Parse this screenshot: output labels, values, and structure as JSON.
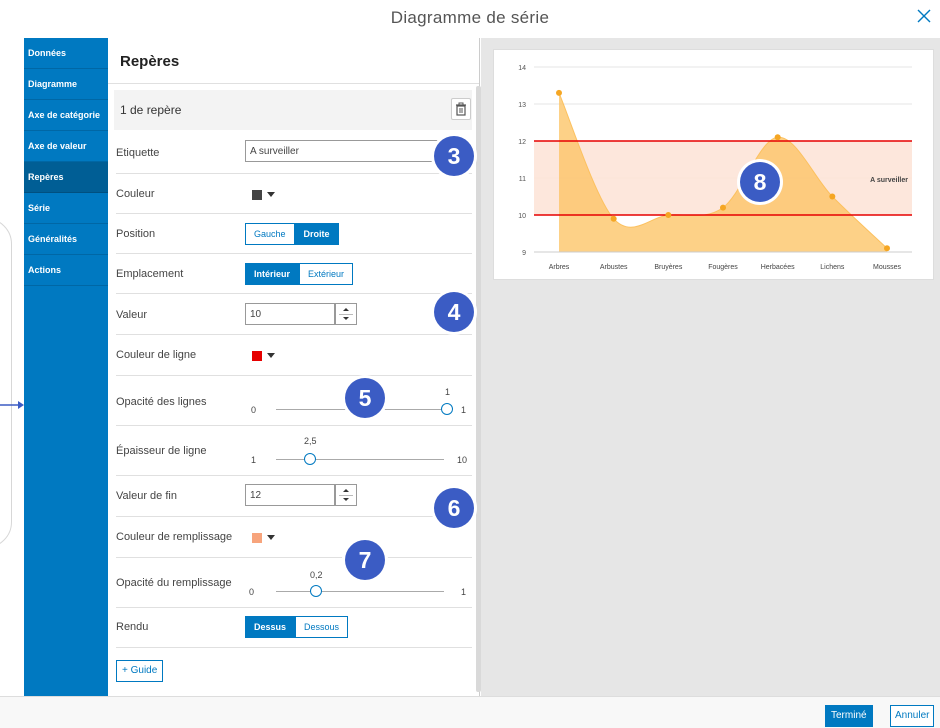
{
  "window": {
    "title": "Diagramme de série"
  },
  "sidebar": {
    "items": [
      {
        "label": "Données"
      },
      {
        "label": "Diagramme"
      },
      {
        "label": "Axe de catégorie"
      },
      {
        "label": "Axe de valeur"
      },
      {
        "label": "Repères",
        "active": true
      },
      {
        "label": "Série"
      },
      {
        "label": "Généralités"
      },
      {
        "label": "Actions"
      }
    ]
  },
  "panel": {
    "title": "Repères",
    "marker_header": "1 de repère",
    "fields": {
      "label": {
        "label": "Etiquette",
        "value": "A surveiller"
      },
      "color": {
        "label": "Couleur",
        "swatch": "#444444"
      },
      "position": {
        "label": "Position",
        "options": [
          "Gauche",
          "Droite"
        ],
        "selected": "Droite"
      },
      "placement": {
        "label": "Emplacement",
        "options": [
          "Intérieur",
          "Extérieur"
        ],
        "selected": "Intérieur"
      },
      "value": {
        "label": "Valeur",
        "value": "10"
      },
      "line_color": {
        "label": "Couleur de ligne",
        "swatch": "#e60000"
      },
      "line_opacity": {
        "label": "Opacité des lignes",
        "min": "0",
        "max": "1",
        "current": "1",
        "fraction": 1.0
      },
      "line_width": {
        "label": "Épaisseur de ligne",
        "min": "1",
        "max": "10",
        "current": "2,5",
        "fraction": 0.167
      },
      "end_value": {
        "label": "Valeur de fin",
        "value": "12"
      },
      "fill_color": {
        "label": "Couleur de remplissage",
        "swatch": "#f7a47c"
      },
      "fill_opacity": {
        "label": "Opacité du remplissage",
        "min": "0",
        "max": "1",
        "current": "0,2",
        "fraction": 0.2
      },
      "render": {
        "label": "Rendu",
        "options": [
          "Dessus",
          "Dessous"
        ],
        "selected": "Dessus"
      }
    },
    "guide_button": "+ Guide"
  },
  "callouts": [
    "3",
    "4",
    "5",
    "6",
    "7",
    "8"
  ],
  "chart_data": {
    "type": "area",
    "categories": [
      "Arbres",
      "Arbustes",
      "Bruyères",
      "Fougères",
      "Herbacées",
      "Lichens",
      "Mousses"
    ],
    "series": [
      {
        "values": [
          13.3,
          9.9,
          10.0,
          10.2,
          12.1,
          10.5,
          9.1
        ]
      }
    ],
    "ylim": [
      9,
      14
    ],
    "yticks": [
      "9",
      "10",
      "11",
      "12",
      "13",
      "14"
    ],
    "guide": {
      "label": "A surveiller",
      "from": 10,
      "to": 12
    },
    "colors": {
      "area": "#fcc15f",
      "point": "#f5a623",
      "guide_line": "#e60000",
      "guide_fill": "#fde3d6"
    },
    "grid": true
  },
  "footer": {
    "done": "Terminé",
    "cancel": "Annuler"
  },
  "colors": {
    "accent": "#0079c1",
    "callout": "#3b5cc4"
  }
}
